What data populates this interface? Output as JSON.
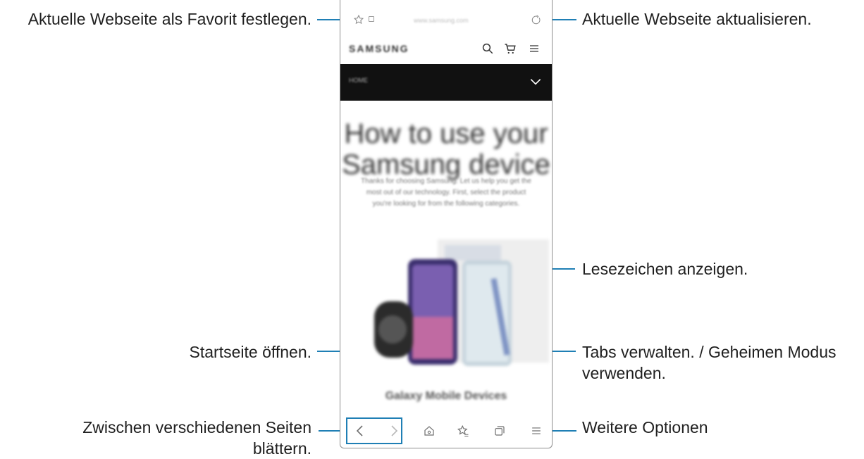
{
  "browser": {
    "url": "www.samsung.com",
    "brand": "SAMSUNG",
    "menu_label": "HOME",
    "hero_title": "How to use your Samsung device",
    "hero_text": "Thanks for choosing Samsung. Let us help you get the most out of our technology. First, select the product you're looking for from the following categories.",
    "section_title": "Galaxy Mobile Devices",
    "icons": [
      "star-icon",
      "lock-icon",
      "refresh-icon",
      "search-icon",
      "cart-icon",
      "hamburger-icon",
      "chevron-down-icon",
      "back-icon",
      "forward-icon",
      "home-icon",
      "bookmarks-icon",
      "tabs-icon",
      "more-icon"
    ]
  },
  "callouts": {
    "favorite": "Aktuelle Webseite als Favorit festlegen.",
    "refresh": "Aktuelle Webseite aktualisieren.",
    "bookmarks": "Lesezeichen anzeigen.",
    "home": "Startseite öffnen.",
    "tabs_line1": "Tabs verwalten. / Geheimen Modus",
    "tabs_line2": "verwenden.",
    "navigate_line1": "Zwischen verschiedenen Seiten",
    "navigate_line2": "blättern.",
    "more": "Weitere Optionen"
  },
  "colors": {
    "accent": "#1f7fb5",
    "navbar_black": "#111111"
  }
}
